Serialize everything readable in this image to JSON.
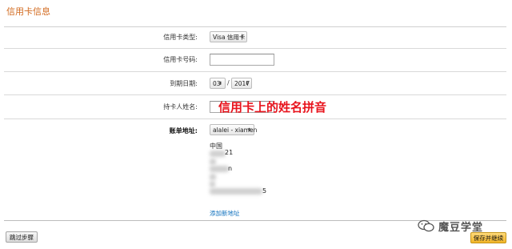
{
  "section_title": "信用卡信息",
  "form": {
    "card_type_label": "信用卡类型:",
    "card_type_value": "Visa 信用卡",
    "card_number_label": "信用卡号码:",
    "card_number_value": "",
    "expiry_label": "到期日期:",
    "expiry_month": "03",
    "expiry_separator": "/",
    "expiry_year": "2017",
    "cardholder_label": "持卡人姓名:",
    "cardholder_value": "",
    "billing_label": "账单地址:",
    "billing_select_value": "alalei - xiamen"
  },
  "annotation": "信用卡上的姓名拼音",
  "address": {
    "country": "中国",
    "line_postcode_tail": "21",
    "line_partial": "n",
    "line_phone_tail": "5"
  },
  "add_address_link": "添加新地址",
  "buttons": {
    "skip": "跳过步骤",
    "save": "保存并继续"
  },
  "watermark": "魔豆学堂",
  "arrow_glyph": "⬍"
}
